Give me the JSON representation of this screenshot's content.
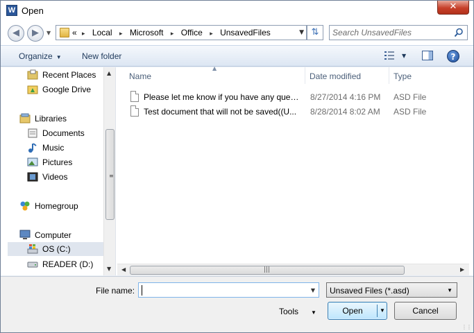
{
  "window": {
    "app_icon": "W",
    "title": "Open",
    "close": "✕"
  },
  "address": {
    "overflow": "«",
    "crumbs": [
      "Local",
      "Microsoft",
      "Office",
      "UnsavedFiles"
    ],
    "search_placeholder": "Search UnsavedFiles"
  },
  "toolbar": {
    "organize": "Organize",
    "new_folder": "New folder",
    "help": "?"
  },
  "nav": {
    "items": [
      {
        "label": "Recent Places",
        "icon": "recent-places-icon"
      },
      {
        "label": "Google Drive",
        "icon": "google-drive-icon"
      },
      {
        "label": "Libraries",
        "icon": "libraries-icon"
      },
      {
        "label": "Documents",
        "icon": "documents-icon"
      },
      {
        "label": "Music",
        "icon": "music-icon"
      },
      {
        "label": "Pictures",
        "icon": "pictures-icon"
      },
      {
        "label": "Videos",
        "icon": "videos-icon"
      },
      {
        "label": "Homegroup",
        "icon": "homegroup-icon"
      },
      {
        "label": "Computer",
        "icon": "computer-icon"
      },
      {
        "label": "OS (C:)",
        "icon": "drive-c-icon"
      },
      {
        "label": "READER (D:)",
        "icon": "drive-d-icon"
      }
    ]
  },
  "files": {
    "columns": {
      "name": "Name",
      "date": "Date modified",
      "type": "Type"
    },
    "rows": [
      {
        "name": "Please let me know if you have any quest...",
        "date": "8/27/2014 4:16 PM",
        "type": "ASD File"
      },
      {
        "name": "Test document that will not be saved((U...",
        "date": "8/28/2014 8:02 AM",
        "type": "ASD File"
      }
    ]
  },
  "bottom": {
    "file_name_label": "File name:",
    "file_name_value": "",
    "file_type": "Unsaved Files (*.asd)",
    "tools": "Tools",
    "open": "Open",
    "cancel": "Cancel"
  }
}
